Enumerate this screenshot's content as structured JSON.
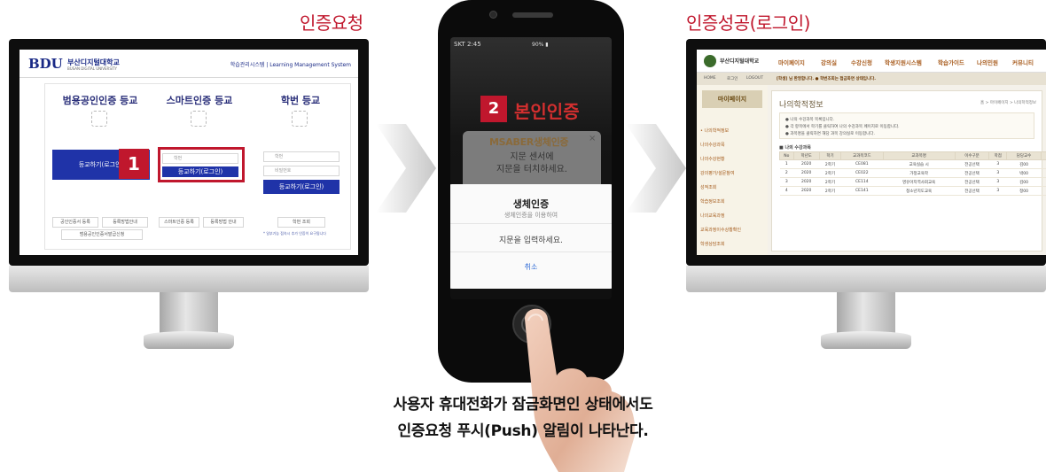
{
  "titles": {
    "request": "인증요청",
    "success": "인증성공(로그인)"
  },
  "login_screen": {
    "logo": "BDU",
    "logo_sub": "부산디지털대학교",
    "logo_sub_en": "BUSAN DIGITAL UNIVERSITY",
    "system_name": "학습관리시스템 | Learning Management System",
    "columns": [
      {
        "title": "범용공인인증 등교",
        "button": "등교하기(로그인)",
        "links": [
          "공인인증서 등록",
          "등록방법안내",
          "범용공인인증서발급신청"
        ]
      },
      {
        "title": "스마트인증 등교",
        "input_placeholder": "학번",
        "button": "등교하기(로그인)",
        "links": [
          "스마트인증 등록",
          "등록방법 안내"
        ]
      },
      {
        "title": "학번 등교",
        "input_id": "학번",
        "input_pw": "비밀번호",
        "button": "등교하기(로그인)",
        "links": [
          "학번 조회"
        ],
        "note": "* 일부기능 접속시 추가 인증이 요구됩니다"
      }
    ],
    "step_badge": "1"
  },
  "phone": {
    "carrier_time": "SKT 2:45",
    "status_right": "90% ▮",
    "step_badge": "2",
    "step_text": "본인인증",
    "msaber_title": "MSABER생체인증",
    "msaber_close": "×",
    "msaber_line1": "지문 센서에",
    "msaber_line2": "지문을 터치하세요.",
    "bio_title": "생체인증",
    "bio_sub": "생체인증을 이용하여",
    "bio_prompt": "지문을 입력하세요.",
    "bio_cancel": "취소"
  },
  "dashboard": {
    "logo_text": "부산디지털대학교",
    "menu": [
      "마이페이지",
      "강의실",
      "수강신청",
      "학생지원시스템",
      "학습가이드",
      "나의민원",
      "커뮤니티"
    ],
    "strip_left": [
      "HOME",
      "로그인",
      "LOGOUT"
    ],
    "strip_alert": "[학생] 님 환영합니다. ● 학번조회는 접금화면 상태입니다.",
    "side_button": "마이페이지",
    "side_items": [
      "• 나의학적정보",
      "나의수강과목",
      "나의수강현황",
      "강의평가/설문참여",
      "성적조회",
      "학습정보조회",
      "나의교육과정",
      "교육과정이수상황확인",
      "학생상담조회"
    ],
    "heading": "나의학적정보",
    "breadcrumb": "홈 > 마이페이지 > 나의학적정보",
    "notes": [
      "● 나의 수강과목 목록입니다.",
      "● 각 항목에서 학기를 클릭하여 나의 수강과목 페이지로 이동합니다.",
      "● 과목명을 클릭하면 해당 과목 강의실로 이동합니다."
    ],
    "table_caption": "■ 나의 수강과목",
    "table_headers": [
      "No",
      "학년도",
      "학기",
      "교과목코드",
      "교과목명",
      "이수구분",
      "학점",
      "담당교수",
      "비고"
    ],
    "table_rows": [
      [
        "1",
        "2020",
        "2학기",
        "CE081",
        "교육실습 시",
        "전공선택",
        "3",
        "김00",
        ""
      ],
      [
        "2",
        "2020",
        "2학기",
        "CE022",
        "가정교육학",
        "전공선택",
        "3",
        "박00",
        ""
      ],
      [
        "3",
        "2020",
        "2학기",
        "CE114",
        "영유아지역사회교육",
        "전공선택",
        "3",
        "김00",
        ""
      ],
      [
        "4",
        "2020",
        "2학기",
        "CE141",
        "청소년지도교육",
        "전공선택",
        "3",
        "정00",
        ""
      ]
    ]
  },
  "caption": {
    "line1": "사용자 휴대전화가 잠금화면인 상태에서도",
    "line2": "인증요청 푸시(Push) 알림이 나타난다."
  }
}
